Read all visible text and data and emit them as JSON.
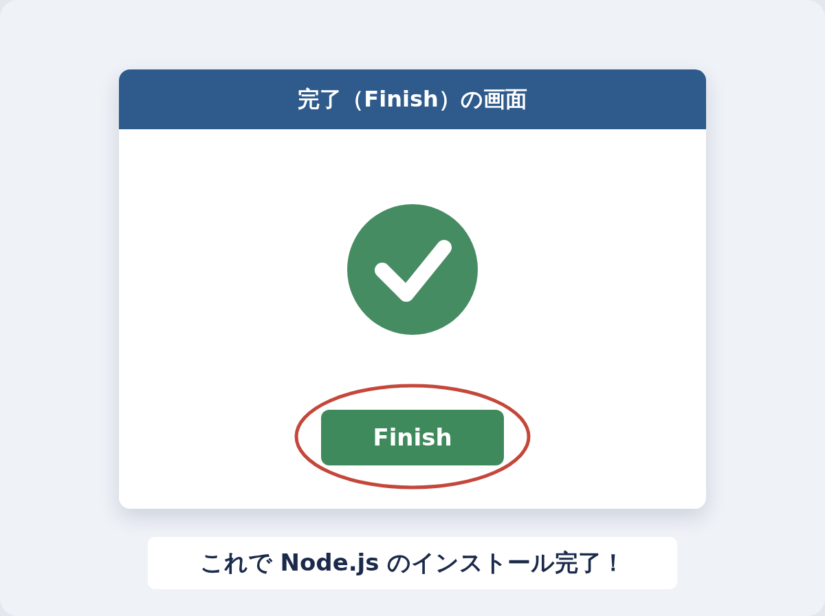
{
  "dialog": {
    "title": "完了（Finish）の画面",
    "button": {
      "label": "Finish",
      "highlighted": true
    }
  },
  "caption": "これで Node.js のインストール完了！"
}
